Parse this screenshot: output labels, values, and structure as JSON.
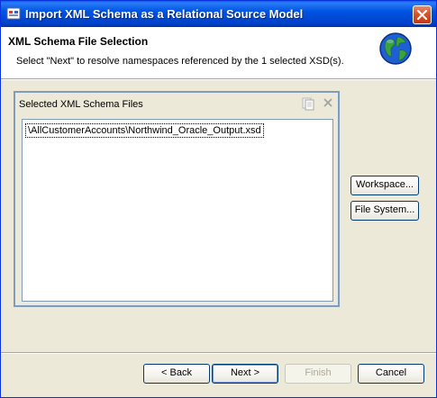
{
  "window": {
    "title": "Import XML Schema as a Relational Source Model"
  },
  "header": {
    "title": "XML Schema File Selection",
    "description": "Select \"Next\" to resolve namespaces referenced by the 1 selected XSD(s)."
  },
  "panel": {
    "title": "Selected XML Schema Files",
    "items": [
      "\\AllCustomerAccounts\\Northwind_Oracle_Output.xsd"
    ]
  },
  "side_buttons": {
    "workspace": "Workspace...",
    "file_system": "File System..."
  },
  "footer": {
    "back": "< Back",
    "next": "Next >",
    "finish": "Finish",
    "cancel": "Cancel"
  },
  "icons": {
    "app": "xml-app-icon",
    "close": "close-icon",
    "wizard": "globe-icon",
    "panel_copy": "copy-icon",
    "panel_close": "close-view-icon"
  },
  "colors": {
    "titlebar": "#0054e3",
    "dialog_background": "#ece9d8",
    "close_button": "#d5532d",
    "panel_border": "#7f9db9"
  }
}
